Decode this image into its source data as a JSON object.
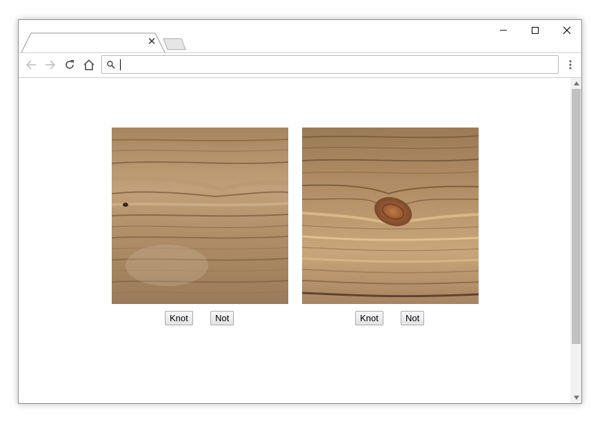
{
  "browser": {
    "tab": {
      "title": "",
      "close_glyph": "✕"
    },
    "address_bar": {
      "value": "",
      "placeholder": ""
    }
  },
  "icons": {
    "back": "arrow-left-icon",
    "forward": "arrow-right-icon",
    "reload": "reload-icon",
    "home": "home-icon",
    "search": "search-icon",
    "menu": "kebab-menu-icon",
    "minimize": "minimize-icon",
    "maximize": "maximize-icon",
    "close": "close-icon"
  },
  "images": [
    {
      "subject": "wood plank without knot",
      "buttons": {
        "knot": "Knot",
        "not": "Not"
      }
    },
    {
      "subject": "wood plank with knot",
      "buttons": {
        "knot": "Knot",
        "not": "Not"
      }
    }
  ],
  "colors": {
    "window_border": "#8a8a8a",
    "scroll_thumb": "#c1c1c1",
    "wood_light": "#c9a77f",
    "wood_dark": "#8a6a4a"
  }
}
